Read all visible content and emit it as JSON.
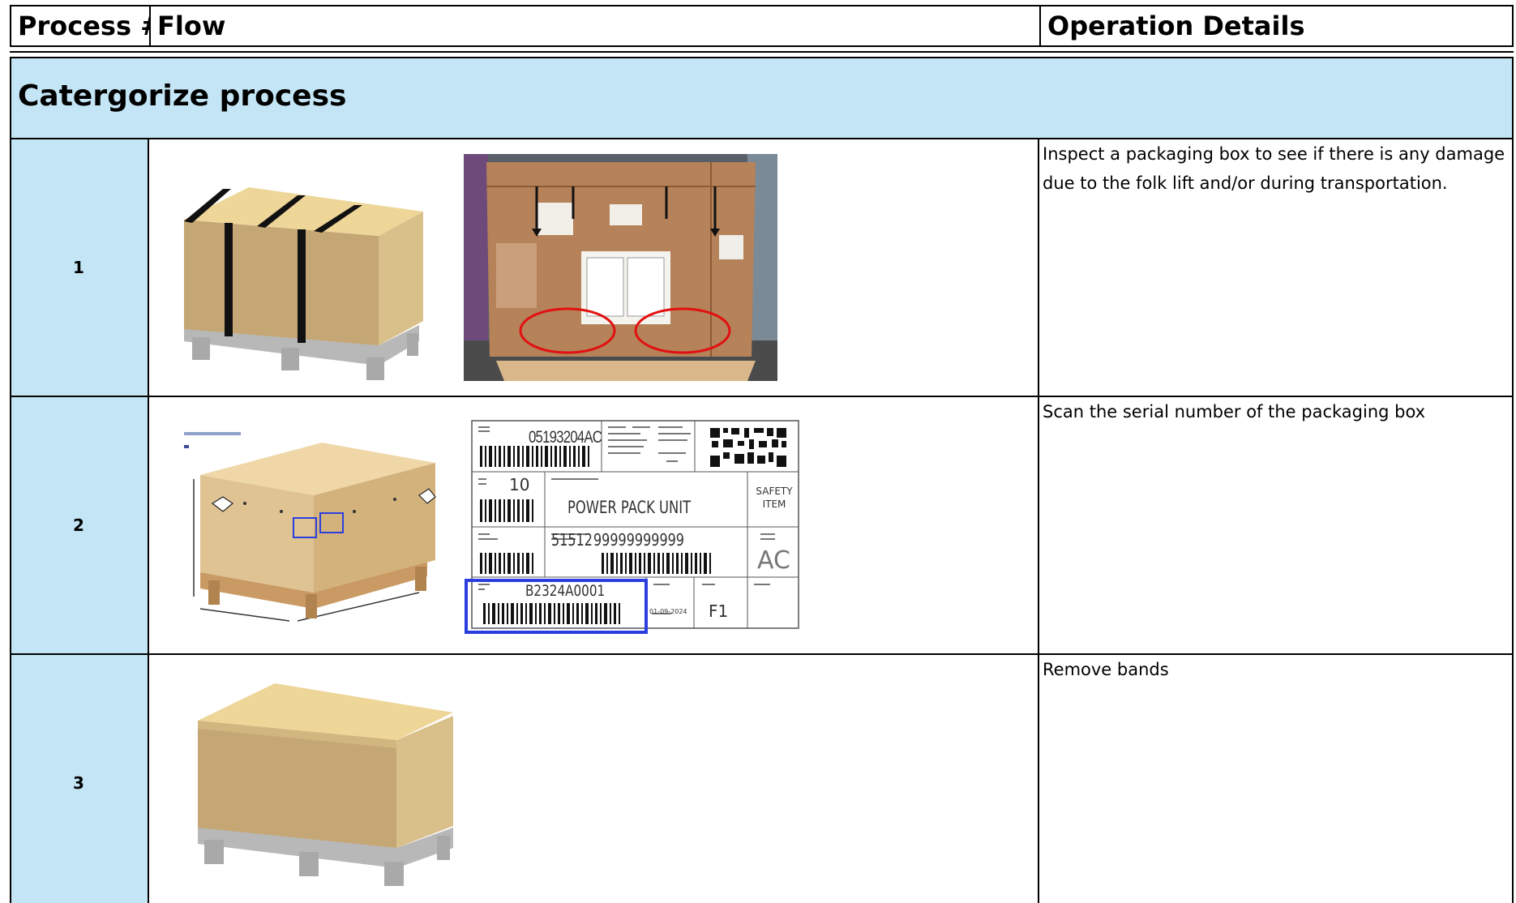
{
  "headers": {
    "process_no": "Process #",
    "flow": "Flow",
    "operation_details": "Operation Details"
  },
  "section": {
    "title": "Catergorize process"
  },
  "rows": [
    {
      "number": "1",
      "details": "Inspect a packaging box to see if there is any damage due to the folk lift and/or during transportation."
    },
    {
      "number": "2",
      "details": "Scan the serial number of the packaging box"
    },
    {
      "number": "3",
      "details": "Remove bands"
    }
  ],
  "label": {
    "part_no": "05193204AC",
    "qty": "10",
    "description": "POWER PACK UNIT",
    "safety": "SAFETY ITEM",
    "supplier": "51512",
    "barcode_no": "99999999999",
    "change_letter": "AC",
    "serial": "B2324A0001",
    "date": "01-09-2024",
    "line": "F1"
  },
  "colors": {
    "section_fill": "#c3e5f5",
    "cardboard": "#d8b97e",
    "highlight_red": "#e21010",
    "highlight_blue": "#2a3ee0"
  }
}
